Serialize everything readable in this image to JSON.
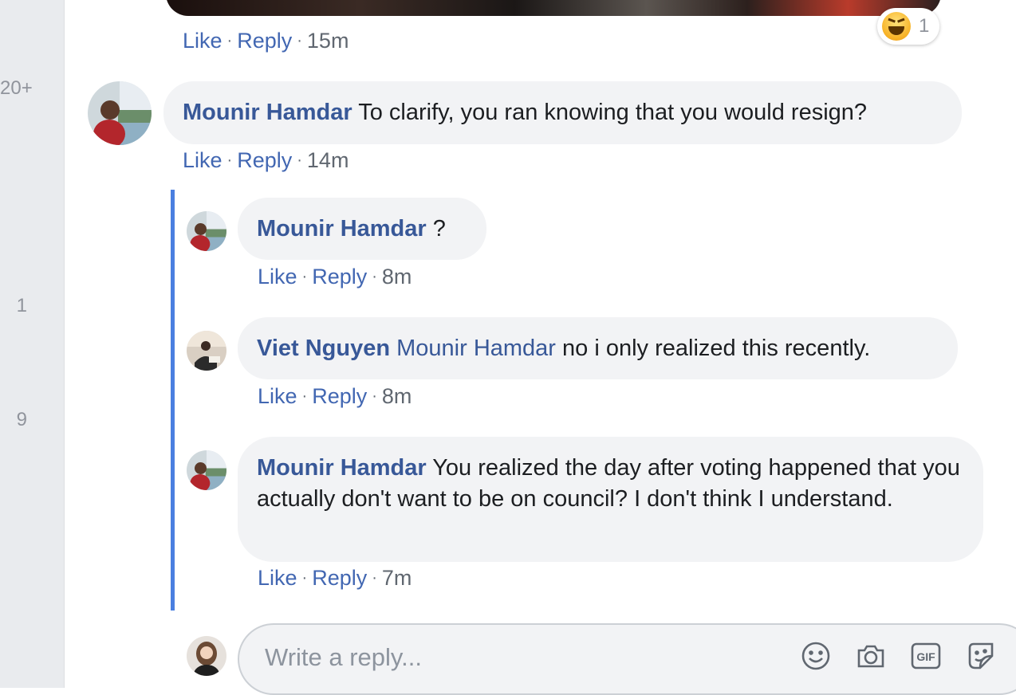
{
  "left_rail": {
    "counts": [
      "20+",
      "1",
      "9"
    ]
  },
  "top_comment": {
    "actions": {
      "like": "Like",
      "reply": "Reply",
      "time": "15m"
    },
    "reaction": {
      "icon": "haha-emoji-icon",
      "count": "1"
    }
  },
  "comments": [
    {
      "author": "Mounir Hamdar",
      "mention": "",
      "text": "To clarify, you ran knowing that you would resign?",
      "actions": {
        "like": "Like",
        "reply": "Reply",
        "time": "14m"
      }
    }
  ],
  "replies": [
    {
      "author": "Mounir Hamdar",
      "mention": "",
      "text": "?",
      "actions": {
        "like": "Like",
        "reply": "Reply",
        "time": "8m"
      }
    },
    {
      "author": "Viet Nguyen",
      "mention": "Mounir Hamdar",
      "text": "no i only realized this recently.",
      "actions": {
        "like": "Like",
        "reply": "Reply",
        "time": "8m"
      }
    },
    {
      "author": "Mounir Hamdar",
      "mention": "",
      "text": "You realized the day after voting happened that you actually don't want to be on council? I don't think I understand.",
      "actions": {
        "like": "Like",
        "reply": "Reply",
        "time": "7m"
      }
    }
  ],
  "reply_box": {
    "placeholder": "Write a reply...",
    "tools": [
      "emoji-icon",
      "camera-icon",
      "gif-icon",
      "sticker-icon"
    ]
  },
  "colors": {
    "link": "#385898",
    "action": "#4267b2",
    "bubble": "#f2f3f5",
    "thread_line": "#4a7fe0",
    "muted": "#606770"
  }
}
